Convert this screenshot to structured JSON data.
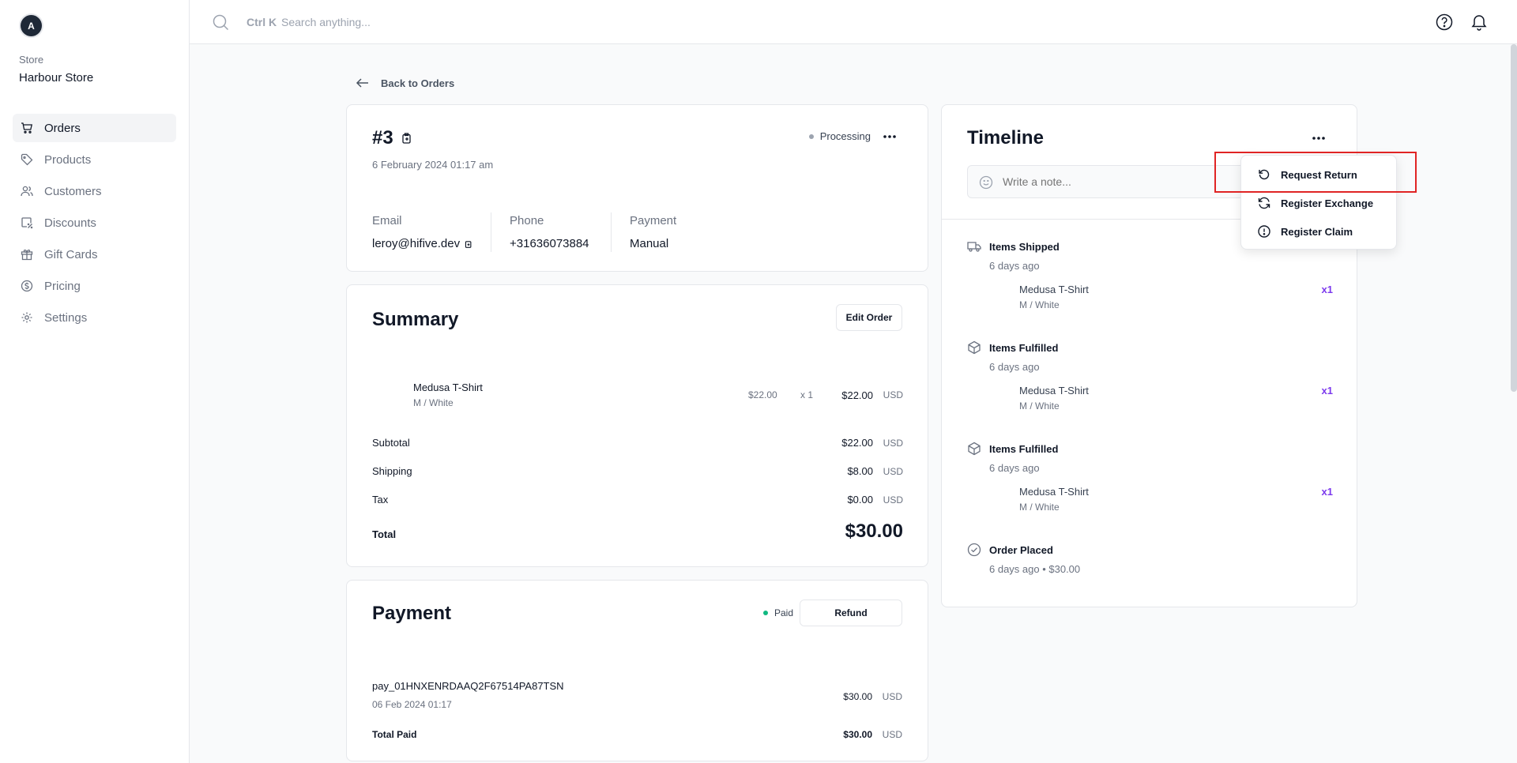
{
  "app": {
    "avatar_letter": "A",
    "store_caption": "Store",
    "store_name": "Harbour Store"
  },
  "sidebar": {
    "items": [
      {
        "label": "Orders",
        "icon": "cart-icon",
        "active": true
      },
      {
        "label": "Products",
        "icon": "tag-icon"
      },
      {
        "label": "Customers",
        "icon": "users-icon"
      },
      {
        "label": "Discounts",
        "icon": "discount-icon"
      },
      {
        "label": "Gift Cards",
        "icon": "gift-icon"
      },
      {
        "label": "Pricing",
        "icon": "pricing-icon"
      },
      {
        "label": "Settings",
        "icon": "gear-icon"
      }
    ]
  },
  "search": {
    "shortcut": "Ctrl K",
    "placeholder": "Search anything..."
  },
  "back_link": "Back to Orders",
  "order": {
    "id": "#3",
    "date": "6 February 2024 01:17 am",
    "status": "Processing",
    "status_color": "#9ca3af",
    "email_label": "Email",
    "email": "leroy@hifive.dev",
    "phone_label": "Phone",
    "phone": "+31636073884",
    "payment_label": "Payment",
    "payment_method": "Manual"
  },
  "summary": {
    "title": "Summary",
    "edit_button": "Edit Order",
    "item": {
      "name": "Medusa T-Shirt",
      "variant": "M / White",
      "unit_price": "$22.00",
      "quantity": "x 1",
      "total": "$22.00",
      "currency": "USD"
    },
    "rows": [
      {
        "label": "Subtotal",
        "value": "$22.00",
        "currency": "USD"
      },
      {
        "label": "Shipping",
        "value": "$8.00",
        "currency": "USD"
      },
      {
        "label": "Tax",
        "value": "$0.00",
        "currency": "USD"
      }
    ],
    "total_label": "Total",
    "total_value": "$30.00"
  },
  "payment": {
    "title": "Payment",
    "status": "Paid",
    "status_color": "#10b981",
    "refund_button": "Refund",
    "payment_id": "pay_01HNXENRDAAQ2F67514PA87TSN",
    "payment_date": "06 Feb 2024 01:17",
    "amount": "$30.00",
    "currency": "USD",
    "total_paid_label": "Total Paid",
    "total_paid_value": "$30.00",
    "total_paid_currency": "USD"
  },
  "timeline": {
    "title": "Timeline",
    "note_placeholder": "Write a note...",
    "events": [
      {
        "title": "Items Shipped",
        "time": "6 days ago",
        "icon": "truck-icon",
        "item": "Medusa T-Shirt",
        "variant": "M / White",
        "qty": "x1"
      },
      {
        "title": "Items Fulfilled",
        "time": "6 days ago",
        "icon": "package-icon",
        "item": "Medusa T-Shirt",
        "variant": "M / White",
        "qty": "x1"
      },
      {
        "title": "Items Fulfilled",
        "time": "6 days ago",
        "icon": "package-icon",
        "item": "Medusa T-Shirt",
        "variant": "M / White",
        "qty": "x1"
      },
      {
        "title": "Order Placed",
        "time": "6 days ago • $30.00",
        "icon": "check-circle-icon"
      }
    ]
  },
  "menu": {
    "items": [
      {
        "label": "Request Return",
        "icon": "undo-icon"
      },
      {
        "label": "Register Exchange",
        "icon": "refresh-icon"
      },
      {
        "label": "Register Claim",
        "icon": "alert-icon"
      }
    ]
  },
  "colors": {
    "accent": "#7c3aed",
    "highlight": "#e02424"
  }
}
